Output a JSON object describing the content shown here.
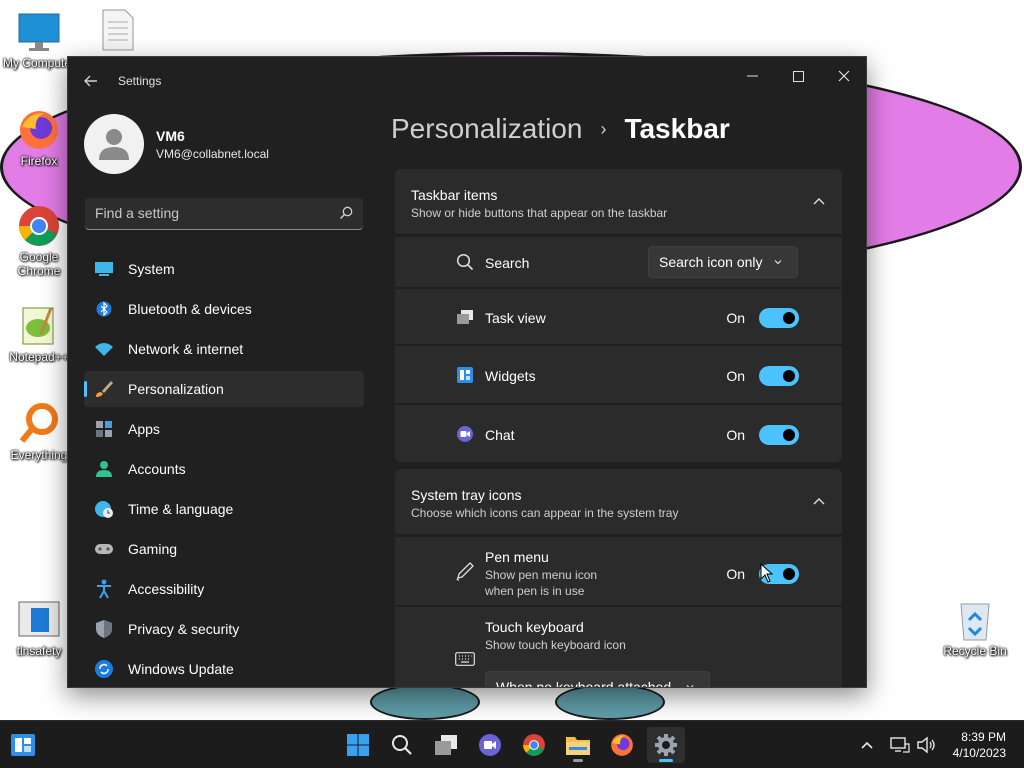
{
  "desktop": {
    "icons": [
      {
        "label": "My Computer",
        "icon": "monitor-icon"
      },
      {
        "label": "",
        "icon": "text-file-icon"
      },
      {
        "label": "Firefox",
        "icon": "firefox-icon"
      },
      {
        "label": "Google Chrome",
        "icon": "chrome-icon"
      },
      {
        "label": "Notepad++",
        "icon": "notepadpp-icon"
      },
      {
        "label": "Everything",
        "icon": "everything-icon"
      },
      {
        "label": "tlnsafety",
        "icon": "window-app-icon"
      },
      {
        "label": "Recycle Bin",
        "icon": "recycle-bin-icon"
      }
    ]
  },
  "window": {
    "title": "Settings",
    "controls": {
      "minimize": "—",
      "maximize": "☐",
      "close": "✕"
    }
  },
  "profile": {
    "name": "VM6",
    "email": "VM6@collabnet.local"
  },
  "search": {
    "placeholder": "Find a setting"
  },
  "nav": {
    "items": [
      {
        "label": "System",
        "icon": "system-display-icon"
      },
      {
        "label": "Bluetooth & devices",
        "icon": "bluetooth-icon"
      },
      {
        "label": "Network & internet",
        "icon": "wifi-icon"
      },
      {
        "label": "Personalization",
        "icon": "paintbrush-icon",
        "active": true
      },
      {
        "label": "Apps",
        "icon": "apps-icon"
      },
      {
        "label": "Accounts",
        "icon": "accounts-icon"
      },
      {
        "label": "Time & language",
        "icon": "time-language-icon"
      },
      {
        "label": "Gaming",
        "icon": "gamepad-icon"
      },
      {
        "label": "Accessibility",
        "icon": "accessibility-icon"
      },
      {
        "label": "Privacy & security",
        "icon": "shield-icon"
      },
      {
        "label": "Windows Update",
        "icon": "windows-update-icon"
      }
    ]
  },
  "breadcrumb": {
    "parent": "Personalization",
    "separator": "›",
    "current": "Taskbar"
  },
  "taskbar_items": {
    "title": "Taskbar items",
    "subtitle": "Show or hide buttons that appear on the taskbar",
    "rows": [
      {
        "label": "Search",
        "control": "dropdown",
        "value": "Search icon only",
        "icon": "search-icon"
      },
      {
        "label": "Task view",
        "control": "toggle",
        "state": "On",
        "icon": "task-view-icon"
      },
      {
        "label": "Widgets",
        "control": "toggle",
        "state": "On",
        "icon": "widgets-icon"
      },
      {
        "label": "Chat",
        "control": "toggle",
        "state": "On",
        "icon": "chat-icon"
      }
    ]
  },
  "system_tray": {
    "title": "System tray icons",
    "subtitle": "Choose which icons can appear in the system tray",
    "rows": [
      {
        "label": "Pen menu",
        "desc_1": "Show pen menu icon",
        "desc_2": "when pen is in use",
        "state": "On",
        "icon": "pen-icon"
      },
      {
        "label": "Touch keyboard",
        "desc_1": "Show touch keyboard icon",
        "value": "When no keyboard attached",
        "icon": "keyboard-icon"
      }
    ]
  },
  "taskbar": {
    "clock_time": "8:39 PM",
    "clock_date": "4/10/2023",
    "overflow": "^"
  },
  "colors": {
    "accent": "#4cc2ff",
    "window_bg": "#202020",
    "card_bg": "#2b2b2b",
    "desktop_blob": "#e27ce6"
  }
}
